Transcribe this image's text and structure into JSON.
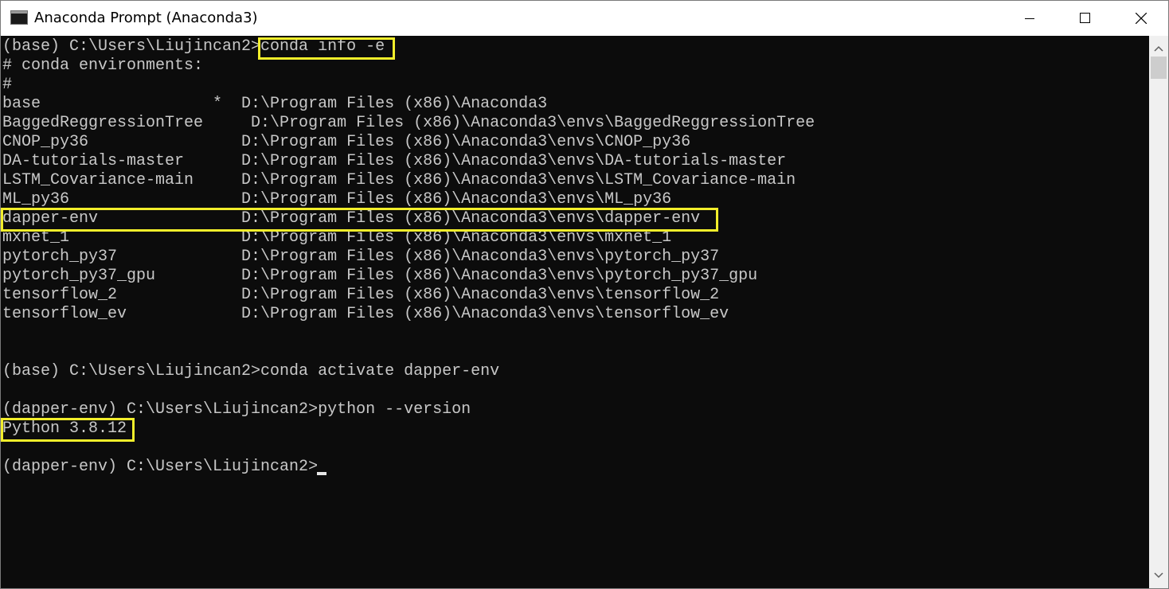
{
  "window": {
    "title": "Anaconda Prompt (Anaconda3)",
    "icon": "console-icon",
    "controls": [
      "minimize-icon",
      "maximize-icon",
      "close-icon"
    ]
  },
  "console": {
    "lines": [
      "(base) C:\\Users\\Liujincan2>conda info -e",
      "# conda environments:",
      "#",
      "base                  *  D:\\Program Files (x86)\\Anaconda3",
      "BaggedReggressionTree     D:\\Program Files (x86)\\Anaconda3\\envs\\BaggedReggressionTree",
      "CNOP_py36                D:\\Program Files (x86)\\Anaconda3\\envs\\CNOP_py36",
      "DA-tutorials-master      D:\\Program Files (x86)\\Anaconda3\\envs\\DA-tutorials-master",
      "LSTM_Covariance-main     D:\\Program Files (x86)\\Anaconda3\\envs\\LSTM_Covariance-main",
      "ML_py36                  D:\\Program Files (x86)\\Anaconda3\\envs\\ML_py36",
      "dapper-env               D:\\Program Files (x86)\\Anaconda3\\envs\\dapper-env",
      "mxnet_1                  D:\\Program Files (x86)\\Anaconda3\\envs\\mxnet_1",
      "pytorch_py37             D:\\Program Files (x86)\\Anaconda3\\envs\\pytorch_py37",
      "pytorch_py37_gpu         D:\\Program Files (x86)\\Anaconda3\\envs\\pytorch_py37_gpu",
      "tensorflow_2             D:\\Program Files (x86)\\Anaconda3\\envs\\tensorflow_2",
      "tensorflow_ev            D:\\Program Files (x86)\\Anaconda3\\envs\\tensorflow_ev",
      "",
      "",
      "(base) C:\\Users\\Liujincan2>conda activate dapper-env",
      "",
      "(dapper-env) C:\\Users\\Liujincan2>python --version",
      "Python 3.8.12",
      "",
      "(dapper-env) C:\\Users\\Liujincan2>"
    ]
  },
  "highlight_color": "#f2ee2b",
  "console_background": "#0c0c0c",
  "console_text_color": "#c8c8c8"
}
